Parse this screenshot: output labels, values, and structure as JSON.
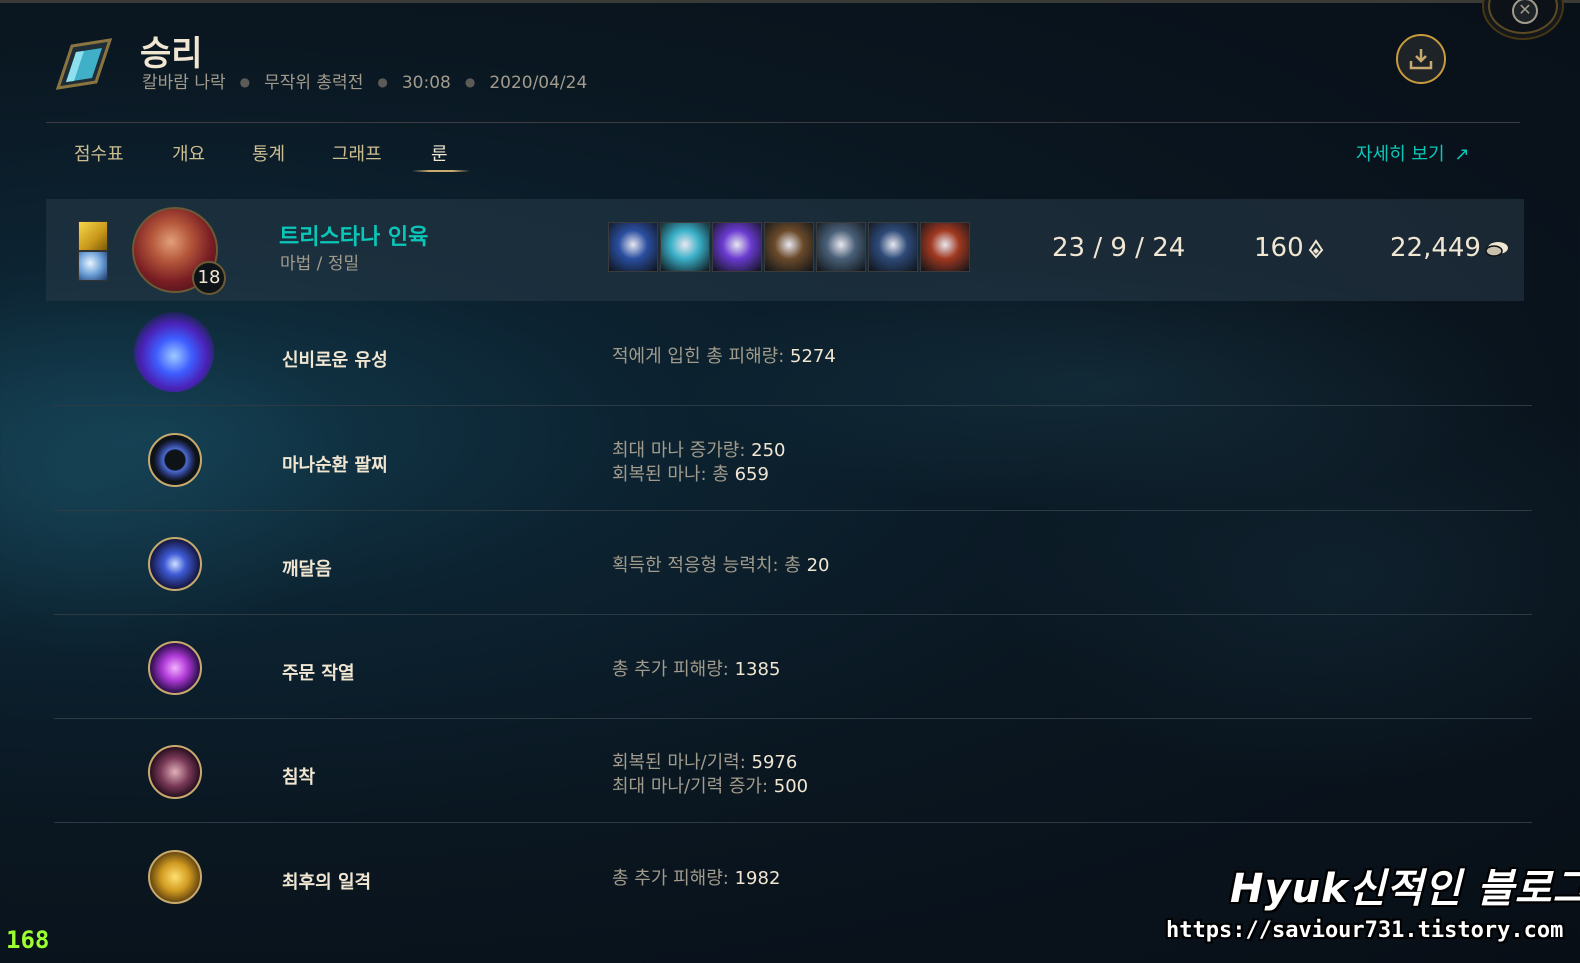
{
  "header": {
    "result": "승리",
    "map": "칼바람 나락",
    "mode": "무작위 총력전",
    "duration": "30:08",
    "date": "2020/04/24"
  },
  "tabs": [
    {
      "label": "점수표",
      "active": false
    },
    {
      "label": "개요",
      "active": false
    },
    {
      "label": "통계",
      "active": false
    },
    {
      "label": "그래프",
      "active": false
    },
    {
      "label": "룬",
      "active": true
    }
  ],
  "details_link": "자세히 보기",
  "player": {
    "name": "트리스타나 인육",
    "rune_trees": "마법 / 정밀",
    "level": "18",
    "kda": "23 / 9 / 24",
    "cs": "160",
    "gold": "22,449",
    "items": [
      {
        "name": "zhonyas-hourglass-icon",
        "color": "#2a4ea0"
      },
      {
        "name": "mask-item-icon",
        "color": "#3ab0c8"
      },
      {
        "name": "purple-orb-item-icon",
        "color": "#6a3ad0"
      },
      {
        "name": "boots-item-icon",
        "color": "#6b4a2a"
      },
      {
        "name": "staff-item-icon",
        "color": "#4a6078"
      },
      {
        "name": "tome-item-icon",
        "color": "#2e4a78"
      },
      {
        "name": "red-spiral-item-icon",
        "color": "#a03820"
      }
    ]
  },
  "runes": [
    {
      "name": "신비로운 유성",
      "icon": "arcane-comet-icon",
      "stats": [
        {
          "label": "적에게 입힌 총 피해량: ",
          "value": "5274"
        }
      ]
    },
    {
      "name": "마나순환 팔찌",
      "icon": "manaflow-band-icon",
      "stats": [
        {
          "label": "최대 마나 증가량: ",
          "value": "250"
        },
        {
          "label": "회복된 마나: 총 ",
          "value": "659"
        }
      ]
    },
    {
      "name": "깨달음",
      "icon": "transcendence-icon",
      "stats": [
        {
          "label": "획득한 적응형 능력치: 총 ",
          "value": "20"
        }
      ]
    },
    {
      "name": "주문 작열",
      "icon": "scorch-icon",
      "stats": [
        {
          "label": "총 추가 피해량: ",
          "value": "1385"
        }
      ]
    },
    {
      "name": "침착",
      "icon": "presence-of-mind-icon",
      "stats": [
        {
          "label": "회복된 마나/기력: ",
          "value": "5976"
        },
        {
          "label": "최대 마나/기력 증가: ",
          "value": "500"
        }
      ]
    },
    {
      "name": "최후의 일격",
      "icon": "coup-de-grace-icon",
      "stats": [
        {
          "label": "총 추가 피해량: ",
          "value": "1982"
        }
      ]
    }
  ],
  "watermark": {
    "title": "Hyuk신적인 블로그",
    "url": "https://saviour731.tistory.com"
  },
  "fps": "168",
  "colors": {
    "accent_teal": "#0ac8b9",
    "gold": "#c8aa6e",
    "text_light": "#f0e6d2",
    "text_muted": "#a09b8c"
  }
}
